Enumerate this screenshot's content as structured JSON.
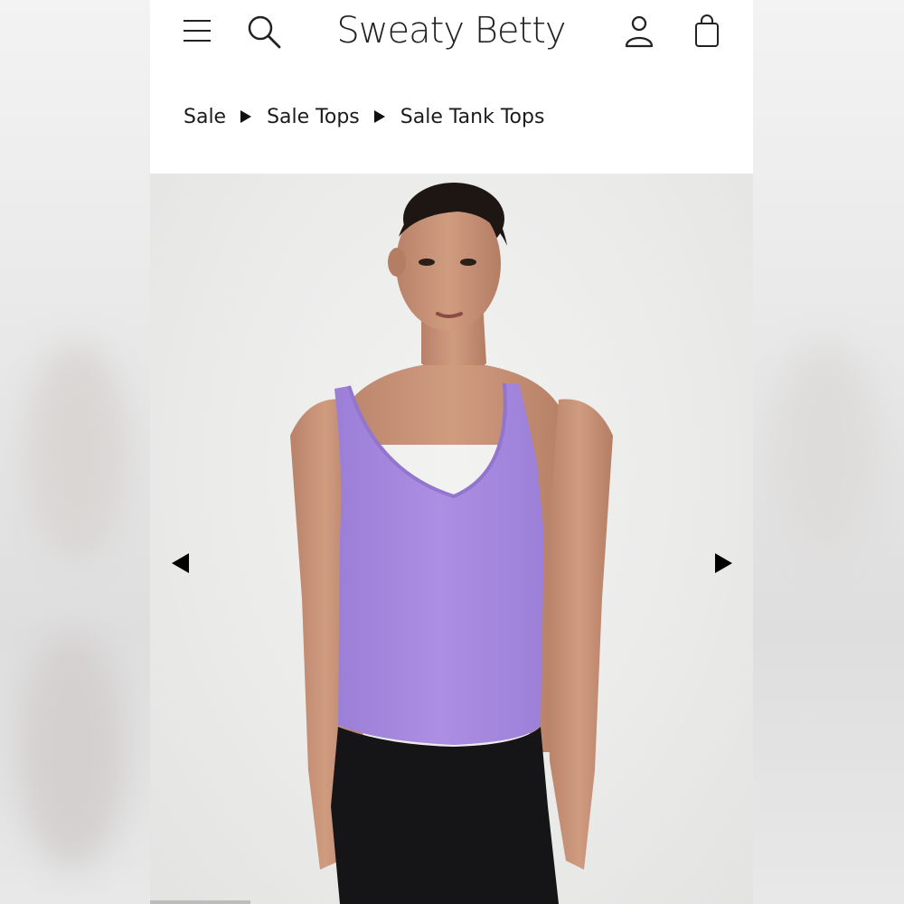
{
  "header": {
    "brand": "Sweaty Betty",
    "icons": [
      "menu-icon",
      "search-icon",
      "account-icon",
      "bag-icon"
    ]
  },
  "breadcrumb": {
    "items": [
      "Sale",
      "Sale Tops",
      "Sale Tank Tops"
    ]
  },
  "gallery": {
    "image": "model-wearing-lilac-v-neck-tank-top",
    "progress": 0.166
  },
  "colors": {
    "tank": "#a98be0",
    "leggings": "#151518",
    "skin": "#c99377",
    "hair": "#1e1612"
  }
}
